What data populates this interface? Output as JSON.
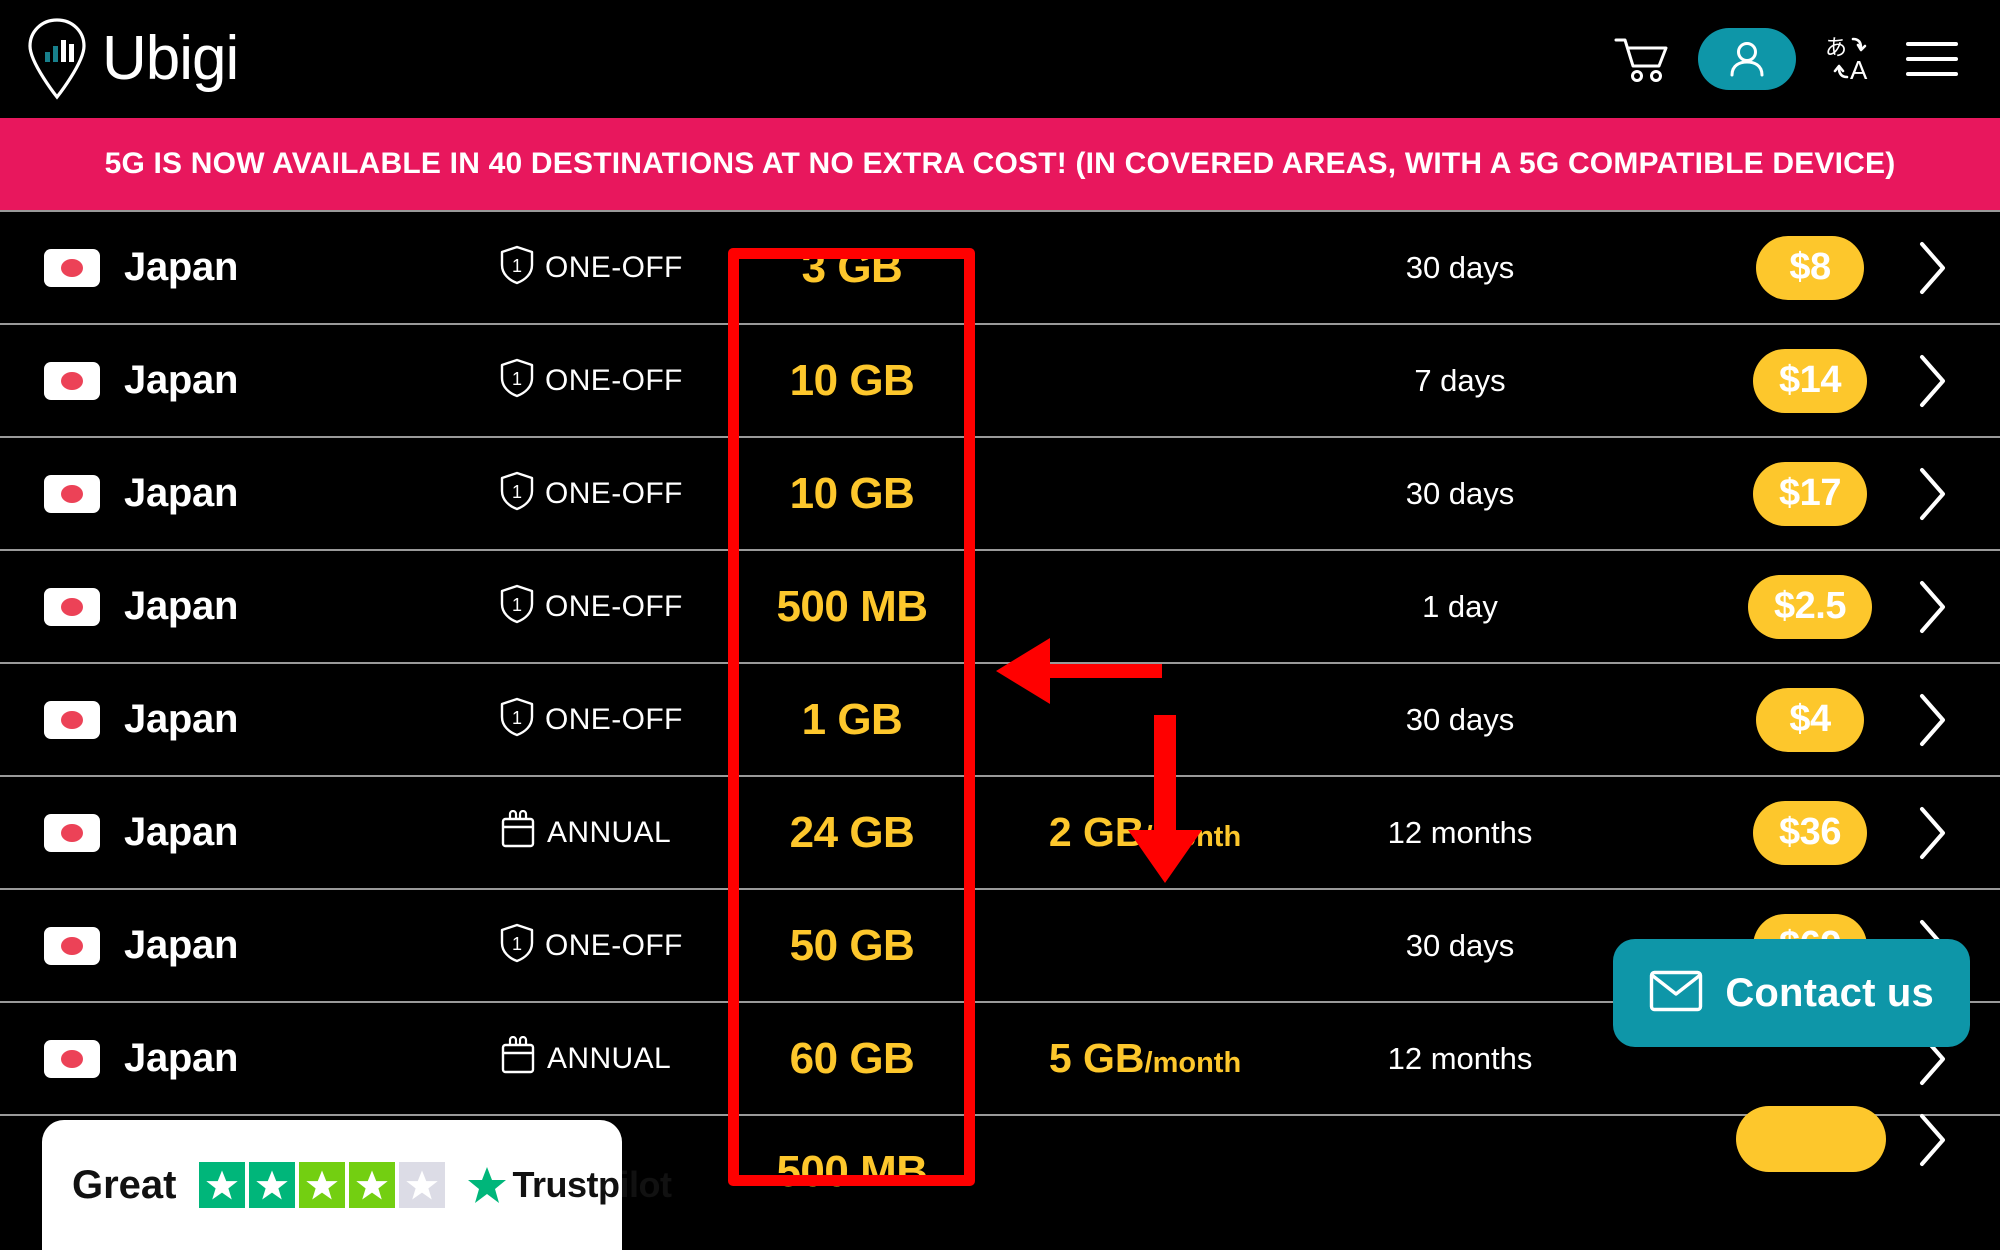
{
  "header": {
    "brand": "Ubigi",
    "icons": [
      {
        "name": "cart-icon",
        "label": "Cart"
      },
      {
        "name": "account-icon",
        "label": "Account"
      },
      {
        "name": "language-icon",
        "label": "Language"
      },
      {
        "name": "menu-icon",
        "label": "Menu"
      }
    ],
    "accent_teal": "#0E96A8"
  },
  "banner": {
    "text": "5G IS NOW AVAILABLE IN 40 DESTINATIONS AT NO EXTRA COST! (IN COVERED AREAS, WITH A 5G COMPATIBLE DEVICE)",
    "background": "#E8175D",
    "color": "#FFFFFF"
  },
  "annotation": {
    "color": "#FF0000",
    "box_label": "data-column-highlight",
    "arrows": [
      "arrow-left",
      "arrow-down"
    ]
  },
  "colors": {
    "data_yellow": "#FDC72C",
    "price_pill": "#FDC72C",
    "row_divider": "#9A9A9A",
    "background": "#000000"
  },
  "partial_row_bottom": {
    "data": "500 MB"
  },
  "plans": [
    {
      "country": "Japan",
      "flag": "jp-flag",
      "type": "ONE-OFF",
      "type_icon": "shield-one-icon",
      "data": "3 GB",
      "per_month": "",
      "per_month_unit": "",
      "duration": "30 days",
      "price": "$8"
    },
    {
      "country": "Japan",
      "flag": "jp-flag",
      "type": "ONE-OFF",
      "type_icon": "shield-one-icon",
      "data": "10 GB",
      "per_month": "",
      "per_month_unit": "",
      "duration": "7 days",
      "price": "$14"
    },
    {
      "country": "Japan",
      "flag": "jp-flag",
      "type": "ONE-OFF",
      "type_icon": "shield-one-icon",
      "data": "10 GB",
      "per_month": "",
      "per_month_unit": "",
      "duration": "30 days",
      "price": "$17"
    },
    {
      "country": "Japan",
      "flag": "jp-flag",
      "type": "ONE-OFF",
      "type_icon": "shield-one-icon",
      "data": "500 MB",
      "per_month": "",
      "per_month_unit": "",
      "duration": "1 day",
      "price": "$2.5"
    },
    {
      "country": "Japan",
      "flag": "jp-flag",
      "type": "ONE-OFF",
      "type_icon": "shield-one-icon",
      "data": "1 GB",
      "per_month": "",
      "per_month_unit": "",
      "duration": "30 days",
      "price": "$4"
    },
    {
      "country": "Japan",
      "flag": "jp-flag",
      "type": "ANNUAL",
      "type_icon": "calendar-icon",
      "data": "24 GB",
      "per_month": "2 GB",
      "per_month_unit": "/month",
      "duration": "12 months",
      "price": "$36"
    },
    {
      "country": "Japan",
      "flag": "jp-flag",
      "type": "ONE-OFF",
      "type_icon": "shield-one-icon",
      "data": "50 GB",
      "per_month": "",
      "per_month_unit": "",
      "duration": "30 days",
      "price": "$69"
    },
    {
      "country": "Japan",
      "flag": "jp-flag",
      "type": "ANNUAL",
      "type_icon": "calendar-icon",
      "data": "60 GB",
      "per_month": "5 GB",
      "per_month_unit": "/month",
      "duration": "12 months",
      "price": ""
    }
  ],
  "trustpilot": {
    "rating_word": "Great",
    "brand": "Trustpilot",
    "stars_filled": 4,
    "stars_total": 5
  },
  "contact": {
    "label": "Contact us",
    "icon": "envelope-icon"
  }
}
